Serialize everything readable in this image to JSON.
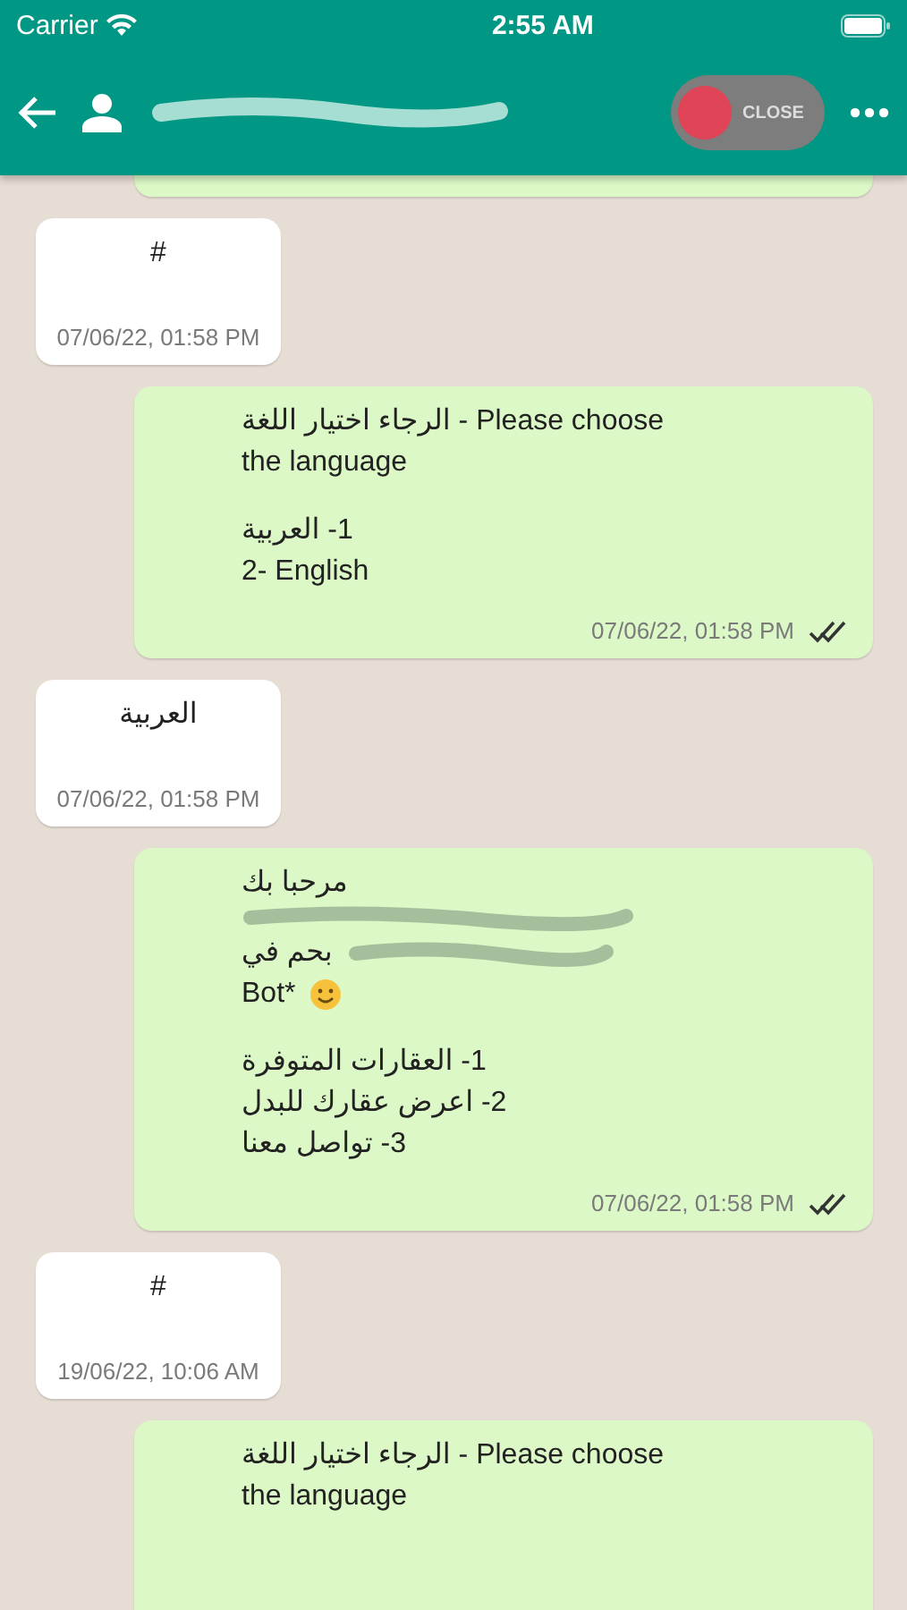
{
  "status_bar": {
    "carrier": "Carrier",
    "time": "2:55 AM"
  },
  "header": {
    "close_switch": {
      "label": "CLOSE",
      "on": false
    }
  },
  "messages": [
    {
      "kind": "clipped"
    },
    {
      "kind": "in",
      "lines": [
        {
          "kind": "text",
          "text": "#"
        }
      ],
      "time": "07/06/22, 01:58 PM"
    },
    {
      "kind": "out",
      "lines": [
        {
          "kind": "mixed",
          "text": "الرجاء اختيار اللغة - Please choose the language"
        },
        {
          "kind": "blank"
        },
        {
          "kind": "text",
          "text": "1- العربية"
        },
        {
          "kind": "text",
          "text": "2- English"
        }
      ],
      "time": "07/06/22, 01:58 PM",
      "read": true
    },
    {
      "kind": "in",
      "lines": [
        {
          "kind": "text",
          "text": "العربية"
        }
      ],
      "time": "07/06/22, 01:58 PM"
    },
    {
      "kind": "out",
      "lines": [
        {
          "kind": "text",
          "text": "مرحبا بك"
        },
        {
          "kind": "redacted"
        },
        {
          "kind": "text",
          "text": "بحم في",
          "redacted": true
        },
        {
          "kind": "text",
          "text": "Bot*",
          "smiley": true
        },
        {
          "kind": "blank"
        },
        {
          "kind": "text",
          "text": "1- العقارات المتوفرة"
        },
        {
          "kind": "text",
          "text": "2- اعرض عقارك للبدل"
        },
        {
          "kind": "text",
          "text": "3- تواصل معنا"
        }
      ],
      "time": "07/06/22, 01:58 PM",
      "read": true
    },
    {
      "kind": "in",
      "lines": [
        {
          "kind": "text",
          "text": "#"
        }
      ],
      "time": "19/06/22, 10:06 AM"
    },
    {
      "kind": "out",
      "lines": [
        {
          "kind": "mixed",
          "text": "الرجاء اختيار اللغة - Please choose the language"
        }
      ]
    }
  ]
}
